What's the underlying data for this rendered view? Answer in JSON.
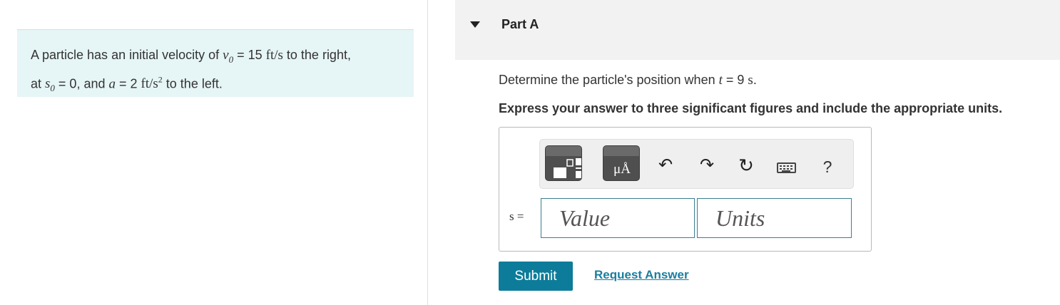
{
  "problem": {
    "line1_before": "A particle has an initial velocity of ",
    "v0_symbol": "v",
    "v0_subscript": "0",
    "eq1": " = 15 ",
    "v0_unit": "ft/s",
    "line1_after": " to the right,",
    "line2_at": "at ",
    "s0_symbol": "s",
    "s0_subscript": "0",
    "eq2": " = 0, and ",
    "a_symbol": "a",
    "eq3": " = 2 ",
    "a_unit": "ft/s",
    "a_unit_exp": "2",
    "line2_after": " to the left."
  },
  "part": {
    "title": "Part A",
    "expanded": true
  },
  "question": {
    "before": "Determine the particle's position when ",
    "t_symbol": "t",
    "eq": " = 9 ",
    "unit": "s",
    "end": "."
  },
  "instruction": "Express your answer to three significant figures and include the appropriate units.",
  "toolbar": {
    "buttons": [
      "templates-icon",
      "units-symbols-icon",
      "undo-icon",
      "redo-icon",
      "reset-icon",
      "keyboard-icon",
      "help-icon"
    ],
    "units_glyph": "μÅ",
    "help_label": "?"
  },
  "answer": {
    "variable_label": "s =",
    "value_placeholder": "Value",
    "units_placeholder": "Units"
  },
  "actions": {
    "submit": "Submit",
    "request_answer": "Request Answer"
  },
  "colors": {
    "intro_bg": "#e6f5f6",
    "submit_bg": "#0d7c9a",
    "link": "#1a7ea0",
    "field_border": "#3b7e91"
  }
}
